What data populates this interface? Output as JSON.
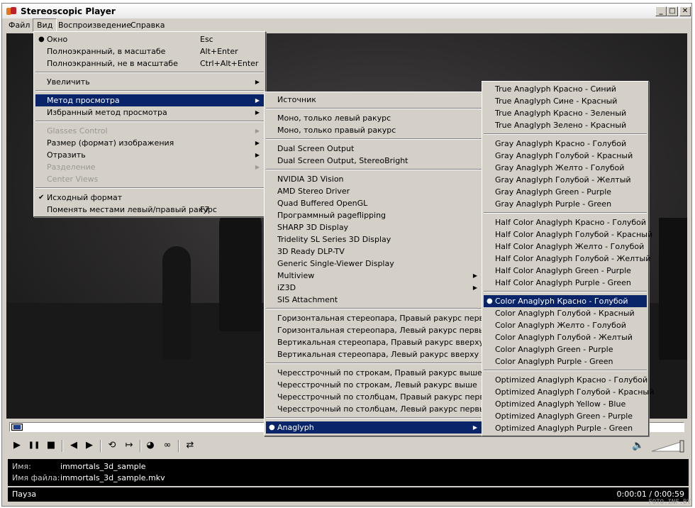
{
  "window": {
    "title": "Stereoscopic Player"
  },
  "titlebar_buttons": {
    "minimize": "_",
    "maximize": "□",
    "close": "✕"
  },
  "menubar": [
    {
      "label": "Файл"
    },
    {
      "label": "Вид"
    },
    {
      "label": "Воспроизведение"
    },
    {
      "label": "Справка"
    }
  ],
  "menu_view": {
    "items": [
      {
        "label": "Окно",
        "shortcut": "Esc",
        "mark": "●"
      },
      {
        "label": "Полноэкранный, в масштабе",
        "shortcut": "Alt+Enter"
      },
      {
        "label": "Полноэкранный, не в масштабе",
        "shortcut": "Ctrl+Alt+Enter"
      },
      {
        "label": "Увеличить",
        "arrow": "▶"
      },
      {
        "label": "Метод просмотра",
        "arrow": "▶"
      },
      {
        "label": "Избранный метод просмотра",
        "arrow": "▶"
      },
      {
        "label": "Glasses Control",
        "arrow": "▶"
      },
      {
        "label": "Размер (формат) изображения",
        "arrow": "▶"
      },
      {
        "label": "Отразить",
        "arrow": "▶"
      },
      {
        "label": "Разделение",
        "arrow": "▶"
      },
      {
        "label": "Center Views"
      },
      {
        "label": "Исходный формат",
        "mark": "✔"
      },
      {
        "label": "Поменять местами левый/правый ракурс",
        "shortcut": "F7"
      }
    ]
  },
  "menu_method": {
    "items": [
      {
        "label": "Источник"
      },
      {
        "label": "Моно, только левый ракурс"
      },
      {
        "label": "Моно, только правый ракурс"
      },
      {
        "label": "Dual Screen Output"
      },
      {
        "label": "Dual Screen Output, StereoBright"
      },
      {
        "label": "NVIDIA 3D Vision"
      },
      {
        "label": "AMD Stereo Driver"
      },
      {
        "label": "Quad Buffered OpenGL"
      },
      {
        "label": "Программный pageflipping"
      },
      {
        "label": "SHARP 3D Display"
      },
      {
        "label": "Tridelity SL Series 3D Display"
      },
      {
        "label": "3D Ready DLP-TV"
      },
      {
        "label": "Generic Single-Viewer Display"
      },
      {
        "label": "Multiview",
        "arrow": "▶"
      },
      {
        "label": "iZ3D",
        "arrow": "▶"
      },
      {
        "label": "SIS Attachment"
      },
      {
        "label": "Горизонтальная стереопара, Правый ракурс первый"
      },
      {
        "label": "Горизонтальная стереопара, Левый ракурс первый"
      },
      {
        "label": "Вертикальная стереопара, Правый ракурс вверху"
      },
      {
        "label": "Вертикальная стереопара, Левый ракурс вверху"
      },
      {
        "label": "Чересстрочный по строкам, Правый ракурс выше"
      },
      {
        "label": "Чересстрочный по строкам, Левый ракурс выше"
      },
      {
        "label": "Чересстрочный по столбцам, Правый ракурс первый"
      },
      {
        "label": "Чересстрочный по столбцам, Левый ракурс первый"
      },
      {
        "label": "Anaglyph",
        "mark": "●",
        "arrow": "▶"
      }
    ]
  },
  "menu_anaglyph": {
    "items": [
      {
        "label": "True Anaglyph Красно - Синий"
      },
      {
        "label": "True Anaglyph Сине - Красный"
      },
      {
        "label": "True Anaglyph Красно - Зеленый"
      },
      {
        "label": "True Anaglyph Зелено - Красный"
      },
      {
        "label": "Gray Anaglyph Красно - Голубой"
      },
      {
        "label": "Gray Anaglyph Голубой - Красный"
      },
      {
        "label": "Gray Anaglyph Желто - Голубой"
      },
      {
        "label": "Gray Anaglyph Голубой - Желтый"
      },
      {
        "label": "Gray Anaglyph Green - Purple"
      },
      {
        "label": "Gray Anaglyph Purple - Green"
      },
      {
        "label": "Half Color Anaglyph Красно - Голубой"
      },
      {
        "label": "Half Color Anaglyph Голубой - Красный"
      },
      {
        "label": "Half Color Anaglyph Желто - Голубой"
      },
      {
        "label": "Half Color Anaglyph Голубой - Желтый"
      },
      {
        "label": "Half Color Anaglyph Green - Purple"
      },
      {
        "label": "Half Color Anaglyph Purple - Green"
      },
      {
        "label": "Color Anaglyph Красно - Голубой",
        "mark": "●"
      },
      {
        "label": "Color Anaglyph Голубой - Красный"
      },
      {
        "label": "Color Anaglyph Желто - Голубой"
      },
      {
        "label": "Color Anaglyph Голубой - Желтый"
      },
      {
        "label": "Color Anaglyph Green - Purple"
      },
      {
        "label": "Color Anaglyph Purple - Green"
      },
      {
        "label": "Optimized Anaglyph Красно - Голубой"
      },
      {
        "label": "Optimized Anaglyph Голубой - Красный"
      },
      {
        "label": "Optimized Anaglyph Yellow - Blue"
      },
      {
        "label": "Optimized Anaglyph Green - Purple"
      },
      {
        "label": "Optimized Anaglyph Purple - Green"
      }
    ]
  },
  "controls": [
    {
      "icon": "play-icon",
      "glyph": "▶"
    },
    {
      "icon": "pause-icon",
      "glyph": "❚❚"
    },
    {
      "icon": "stop-icon",
      "glyph": "■"
    },
    {
      "icon": "prev-frame-icon",
      "glyph": "◀"
    },
    {
      "icon": "next-frame-icon",
      "glyph": "▶"
    },
    {
      "icon": "loop-icon",
      "glyph": "⟲"
    },
    {
      "icon": "ab-repeat-icon",
      "glyph": "↦"
    },
    {
      "icon": "glasses-icon",
      "glyph": "◕"
    },
    {
      "icon": "anaglyph-glasses-icon",
      "glyph": "∞"
    },
    {
      "icon": "swap-lr-icon",
      "glyph": "⇄"
    }
  ],
  "volume": {
    "icon": "speaker-icon",
    "glyph": "🔈"
  },
  "info": {
    "name_label": "Имя:",
    "name_value": "immortals_3d_sample",
    "file_label": "Имя файла:",
    "file_value": "immortals_3d_sample.mkv"
  },
  "status": {
    "state": "Пауза",
    "time": "0:00:01 / 0:00:59"
  },
  "watermark": "FOTO.INF.BY",
  "colors": {
    "selection": "#0a246a",
    "face": "#d4d0c8"
  }
}
